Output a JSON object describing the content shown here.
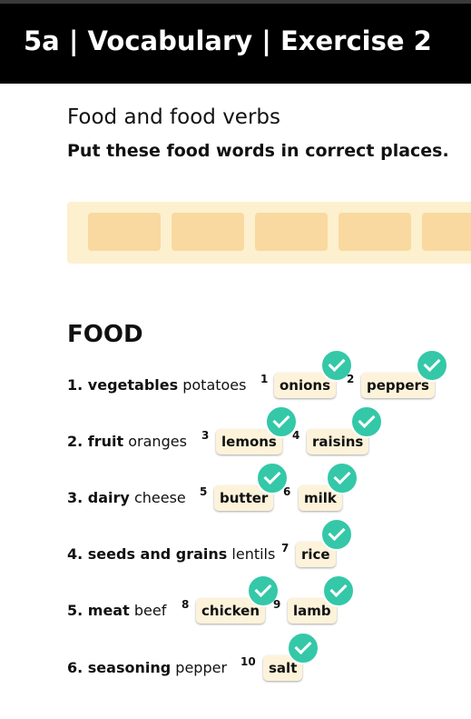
{
  "header": {
    "title": "5a | Vocabulary | Exercise 2"
  },
  "section": {
    "title": "Food and food verbs",
    "instruction": "Put these food words in correct places."
  },
  "word_bank": {
    "slot_count": 5
  },
  "category_heading": "FOOD",
  "rows": [
    {
      "category": "1. vegetables",
      "example": "potatoes",
      "answers": [
        {
          "number": "1",
          "word": "onions",
          "correct": true
        },
        {
          "number": "2",
          "word": "peppers",
          "correct": true
        }
      ]
    },
    {
      "category": "2. fruit",
      "example": "oranges",
      "answers": [
        {
          "number": "3",
          "word": "lemons",
          "correct": true
        },
        {
          "number": "4",
          "word": "raisins",
          "correct": true
        }
      ]
    },
    {
      "category": "3. dairy",
      "example": "cheese",
      "answers": [
        {
          "number": "5",
          "word": "butter",
          "correct": true
        },
        {
          "number": "6",
          "word": "milk",
          "correct": true
        }
      ]
    },
    {
      "category": "4. seeds and grains",
      "example": "lentils",
      "answers": [
        {
          "number": "7",
          "word": "rice",
          "correct": true
        }
      ]
    },
    {
      "category": "5. meat",
      "example": "beef",
      "answers": [
        {
          "number": "8",
          "word": "chicken",
          "correct": true
        },
        {
          "number": "9",
          "word": "lamb",
          "correct": true
        }
      ]
    },
    {
      "category": "6. seasoning",
      "example": "pepper",
      "answers": [
        {
          "number": "10",
          "word": "salt",
          "correct": true
        }
      ]
    }
  ],
  "colors": {
    "header_bg": "#000000",
    "check": "#34c8a8",
    "tray": "#fdf0cf",
    "slot": "#f9d9a0",
    "chip": "#fdf3da"
  },
  "icons": {
    "correct": "check-circle-icon"
  }
}
